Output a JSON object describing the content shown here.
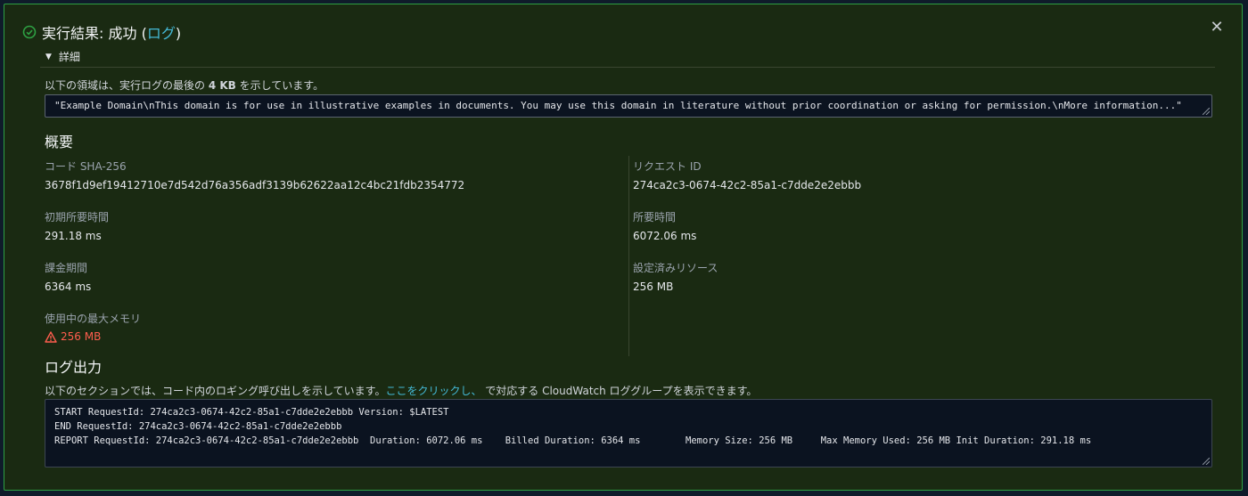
{
  "header": {
    "title_prefix": "実行結果: 成功 (",
    "log_link": "ログ",
    "title_suffix": ")",
    "close_glyph": "✕"
  },
  "details": {
    "toggle_label": "詳細",
    "desc_before": "以下の領域は、実行ログの最後の ",
    "desc_bold": "4 KB",
    "desc_after": " を示しています。",
    "result_text": "\"Example Domain\\nThis domain is for use in illustrative examples in documents. You may use this domain in literature without prior coordination or asking for permission.\\nMore information...\""
  },
  "summary": {
    "heading": "概要",
    "fields": {
      "code_sha": {
        "label": "コード SHA-256",
        "value": "3678f1d9ef19412710e7d542d76a356adf3139b62622aa12c4bc21fdb2354772"
      },
      "request_id": {
        "label": "リクエスト ID",
        "value": "274ca2c3-0674-42c2-85a1-c7dde2e2ebbb"
      },
      "init_duration": {
        "label": "初期所要時間",
        "value": "291.18 ms"
      },
      "duration": {
        "label": "所要時間",
        "value": "6072.06 ms"
      },
      "billed_duration": {
        "label": "課金期間",
        "value": "6364 ms"
      },
      "configured_resources": {
        "label": "設定済みリソース",
        "value": "256 MB"
      },
      "max_memory": {
        "label": "使用中の最大メモリ",
        "value": "256 MB"
      }
    }
  },
  "log_output": {
    "heading": "ログ出力",
    "desc_before": "以下のセクションでは、コード内のロギング呼び出しを示しています。",
    "link": "ここをクリックし、",
    "desc_after": " で対応する CloudWatch ロググループを表示できます。",
    "lines": [
      "START RequestId: 274ca2c3-0674-42c2-85a1-c7dde2e2ebbb Version: $LATEST",
      "END RequestId: 274ca2c3-0674-42c2-85a1-c7dde2e2ebbb",
      "REPORT RequestId: 274ca2c3-0674-42c2-85a1-c7dde2e2ebbb  Duration: 6072.06 ms    Billed Duration: 6364 ms        Memory Size: 256 MB     Max Memory Used: 256 MB Init Duration: 291.18 ms"
    ]
  },
  "colors": {
    "success": "#2ea043",
    "link": "#44b9d6",
    "warning": "#ff5d4e",
    "panel_bg": "#1a2a12"
  }
}
